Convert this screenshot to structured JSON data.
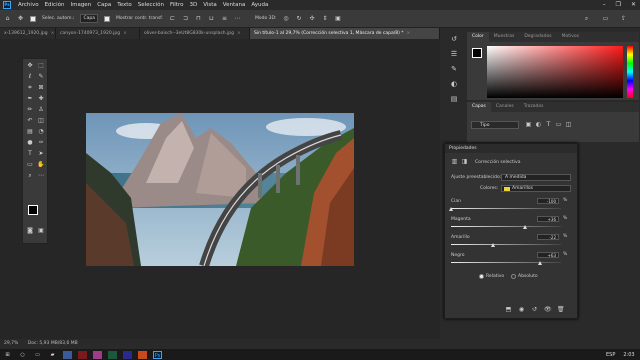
{
  "menu": {
    "app_logo": "Ps",
    "items": [
      "Archivo",
      "Edición",
      "Imagen",
      "Capa",
      "Texto",
      "Selección",
      "Filtro",
      "3D",
      "Vista",
      "Ventana",
      "Ayuda"
    ],
    "window_controls": [
      "–",
      "❐",
      "✕"
    ]
  },
  "options": {
    "select_auto_label": "Selec. autom.:",
    "select_auto_value": "Capa",
    "show_transform_label": "Mostrar contr. transf.",
    "mode3d_label": "Modo 3D:"
  },
  "tabs": [
    {
      "label": "x-139612_1920.jpg",
      "active": false
    },
    {
      "label": "canyon-1740973_1920.jpg",
      "active": false
    },
    {
      "label": "oliver-baisch--3eUt8G830k-unsplash.jpg",
      "active": false
    },
    {
      "label": "Sin título-1 al 29,7% (Corrección selectiva 1, Máscara de capa/8) *",
      "active": true
    }
  ],
  "status": {
    "zoom": "29,7%",
    "doc_info": "Doc: 5,93 MB/83,6 MB"
  },
  "color_panel": {
    "tabs": [
      "Color",
      "Muestras",
      "Degradados",
      "Motivos"
    ]
  },
  "layers_panel": {
    "tabs": [
      "Capas",
      "Canales",
      "Trazados"
    ],
    "filter_label": "Tipo"
  },
  "properties": {
    "title": "Propiedades",
    "adjustment_name": "Corrección selectiva",
    "preset_label": "Ajuste preestablecido:",
    "preset_value": "A medida",
    "colors_label": "Colores:",
    "colors_value": "Amarillos",
    "sliders": [
      {
        "name": "Cian",
        "value": "-100",
        "unit": "%",
        "level": 0.0
      },
      {
        "name": "Magenta",
        "value": "+36",
        "unit": "%",
        "level": 0.68
      },
      {
        "name": "Amarillo",
        "value": "-22",
        "unit": "%",
        "level": 0.39
      },
      {
        "name": "Negro",
        "value": "+63",
        "unit": "%",
        "level": 0.815
      }
    ],
    "method_relative": "Relativo",
    "method_absolute": "Absoluto"
  },
  "taskbar": {
    "time": "2:03",
    "lang": "ESP"
  },
  "colors": {
    "accent": "#31a8ff",
    "yellow_swatch": "#f3d33a"
  }
}
